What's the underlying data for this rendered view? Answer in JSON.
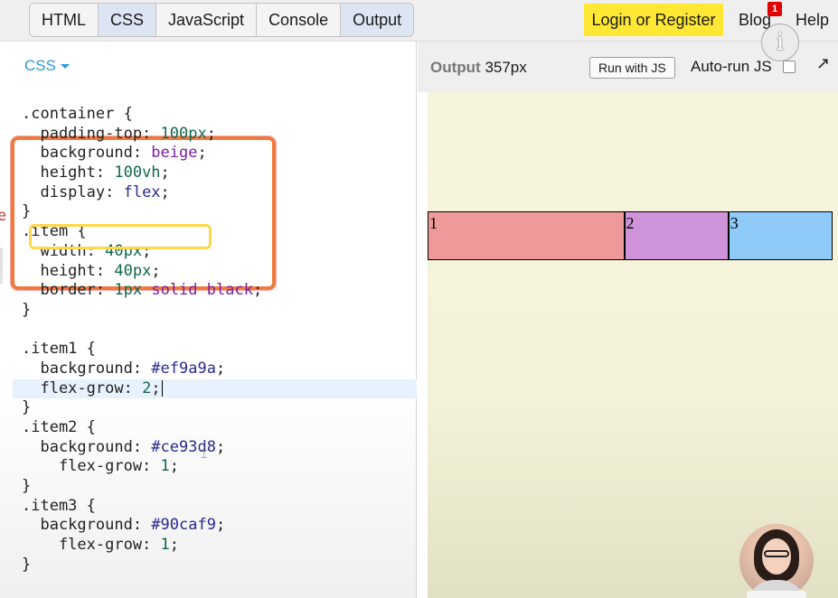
{
  "toolbar": {
    "tabs": [
      {
        "label": "HTML"
      },
      {
        "label": "CSS"
      },
      {
        "label": "JavaScript"
      },
      {
        "label": "Console"
      },
      {
        "label": "Output"
      }
    ],
    "login_label": "Login or Register",
    "blog_label": "Blog",
    "blog_badge": "1",
    "help_label": "Help",
    "info_glyph": "i"
  },
  "editor": {
    "language": "CSS",
    "stray_char": "e",
    "lines": [
      [
        {
          "t": ".container {",
          "c": "prop"
        }
      ],
      [
        {
          "t": "  padding-top: ",
          "c": "prop"
        },
        {
          "t": "100px",
          "c": "num"
        },
        {
          "t": ";",
          "c": "prop"
        }
      ],
      [
        {
          "t": "  background: ",
          "c": "prop"
        },
        {
          "t": "beige",
          "c": "kw"
        },
        {
          "t": ";",
          "c": "prop"
        }
      ],
      [
        {
          "t": "  height: ",
          "c": "prop"
        },
        {
          "t": "100vh",
          "c": "num"
        },
        {
          "t": ";",
          "c": "prop"
        }
      ],
      [
        {
          "t": "  display: ",
          "c": "prop"
        },
        {
          "t": "flex",
          "c": "hex"
        },
        {
          "t": ";",
          "c": "prop"
        }
      ],
      [
        {
          "t": "}",
          "c": "prop"
        }
      ],
      [
        {
          "t": ".item {",
          "c": "prop"
        }
      ],
      [
        {
          "t": "  width: ",
          "c": "prop"
        },
        {
          "t": "40px",
          "c": "num"
        },
        {
          "t": ";",
          "c": "prop"
        }
      ],
      [
        {
          "t": "  height: ",
          "c": "prop"
        },
        {
          "t": "40px",
          "c": "num"
        },
        {
          "t": ";",
          "c": "prop"
        }
      ],
      [
        {
          "t": "  border: ",
          "c": "prop"
        },
        {
          "t": "1px",
          "c": "num"
        },
        {
          "t": " ",
          "c": "prop"
        },
        {
          "t": "solid",
          "c": "kw"
        },
        {
          "t": " ",
          "c": "prop"
        },
        {
          "t": "black",
          "c": "kw"
        },
        {
          "t": ";",
          "c": "prop"
        }
      ],
      [
        {
          "t": "}",
          "c": "prop"
        }
      ],
      [
        {
          "t": "",
          "c": "prop"
        }
      ],
      [
        {
          "t": ".item1 {",
          "c": "prop"
        }
      ],
      [
        {
          "t": "  background: ",
          "c": "prop"
        },
        {
          "t": "#ef9a9a",
          "c": "hex"
        },
        {
          "t": ";",
          "c": "prop"
        }
      ],
      [
        {
          "t": "  flex-grow: ",
          "c": "prop"
        },
        {
          "t": "2",
          "c": "num"
        },
        {
          "t": ";",
          "c": "prop"
        }
      ],
      [
        {
          "t": "}",
          "c": "prop"
        }
      ],
      [
        {
          "t": ".item2 {",
          "c": "prop"
        }
      ],
      [
        {
          "t": "  background: ",
          "c": "prop"
        },
        {
          "t": "#ce93d8",
          "c": "hex"
        },
        {
          "t": ";",
          "c": "prop"
        }
      ],
      [
        {
          "t": "    flex-grow: ",
          "c": "prop"
        },
        {
          "t": "1",
          "c": "num"
        },
        {
          "t": ";",
          "c": "prop"
        }
      ],
      [
        {
          "t": "}",
          "c": "prop"
        }
      ],
      [
        {
          "t": ".item3 {",
          "c": "prop"
        }
      ],
      [
        {
          "t": "  background: ",
          "c": "prop"
        },
        {
          "t": "#90caf9",
          "c": "hex"
        },
        {
          "t": ";",
          "c": "prop"
        }
      ],
      [
        {
          "t": "    flex-grow: ",
          "c": "prop"
        },
        {
          "t": "1",
          "c": "num"
        },
        {
          "t": ";",
          "c": "prop"
        }
      ],
      [
        {
          "t": "}",
          "c": "prop"
        }
      ]
    ],
    "current_line_index": 14
  },
  "output": {
    "label": "Output",
    "width_text": "357px",
    "run_label": "Run with JS",
    "autorun_label": "Auto-run JS",
    "expand_glyph": "↗",
    "items": [
      {
        "label": "1",
        "color": "#ef9a9a"
      },
      {
        "label": "2",
        "color": "#ce93d8"
      },
      {
        "label": "3",
        "color": "#90caf9"
      }
    ],
    "container_bg": "beige"
  },
  "colors": {
    "accent_link": "#2b9bd7",
    "login_bg": "#ffe733",
    "badge_bg": "#e10000",
    "highlight_outer": "#f07a3c",
    "highlight_inner": "#ffd84a"
  }
}
